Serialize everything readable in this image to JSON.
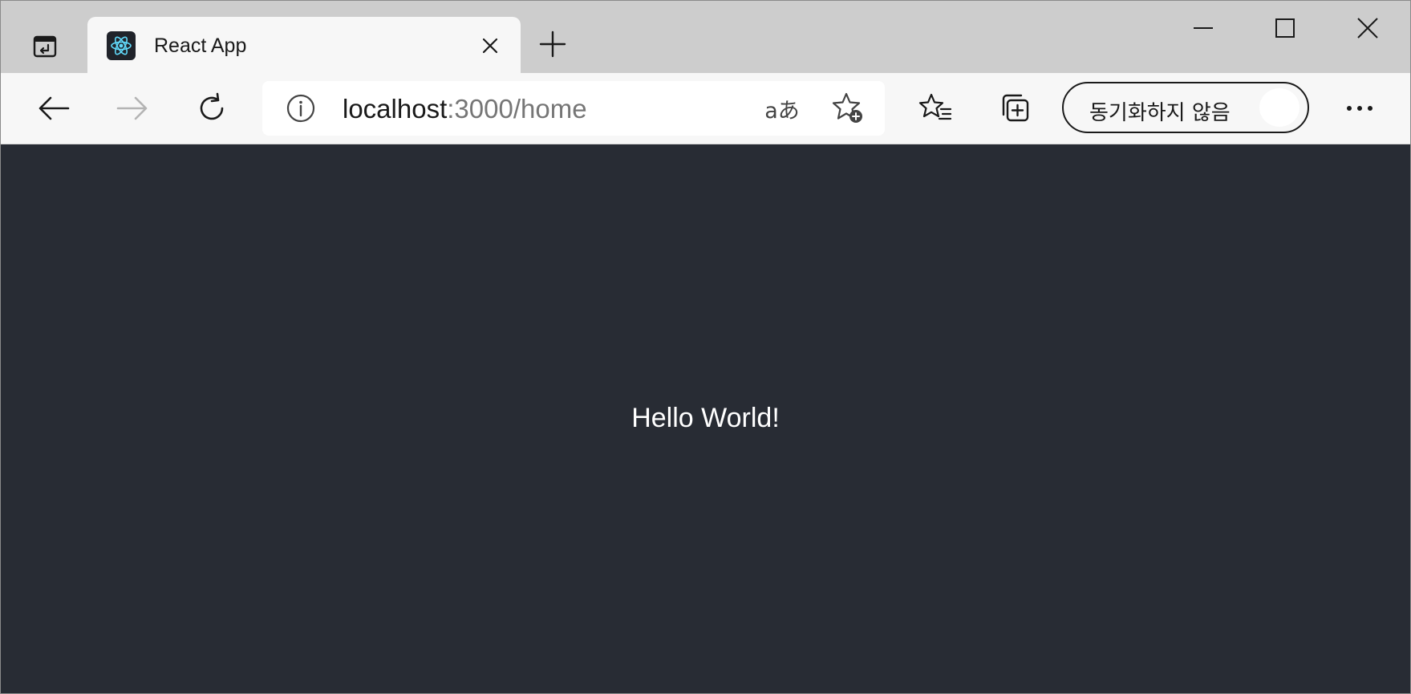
{
  "window": {
    "tab": {
      "title": "React App"
    }
  },
  "toolbar": {
    "address": {
      "host": "localhost",
      "path": ":3000/home"
    },
    "translate_glyph": "aあ",
    "profile": {
      "label": "동기화하지 않음"
    }
  },
  "page": {
    "background": "#282c34",
    "text": "Hello World!"
  },
  "icons": {
    "tab_actions": "tab-actions-icon",
    "favicon": "react-logo-icon",
    "close": "close-icon",
    "new_tab": "plus-icon",
    "minimize": "minimize-icon",
    "maximize": "maximize-icon",
    "window_close": "window-close-icon",
    "back": "back-arrow-icon",
    "forward": "forward-arrow-icon",
    "refresh": "refresh-icon",
    "site_info": "info-icon",
    "add_favorite": "star-add-icon",
    "favorites": "favorites-icon",
    "collections": "collections-icon",
    "more": "more-icon"
  }
}
